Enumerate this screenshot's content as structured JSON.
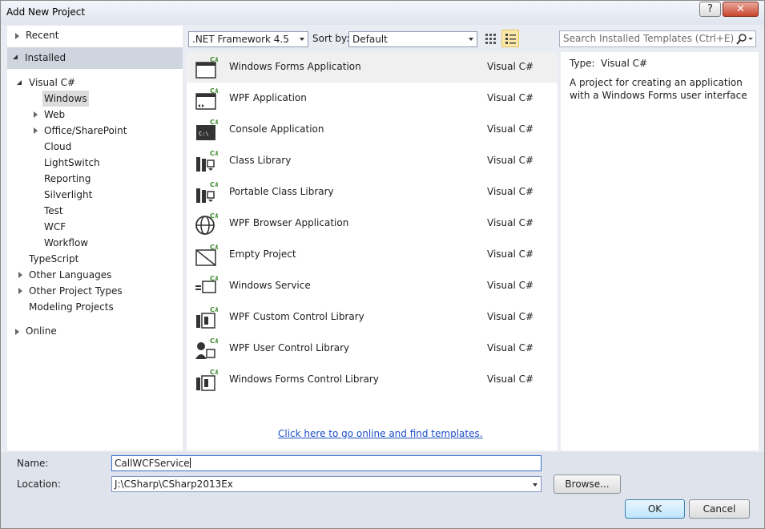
{
  "window": {
    "title": "Add New Project",
    "help_label": "?",
    "close_label": "✕"
  },
  "left": {
    "recent": "Recent",
    "installed": "Installed",
    "online": "Online",
    "tree": [
      {
        "label": "Visual C#",
        "level": 1,
        "expander": "open"
      },
      {
        "label": "Windows",
        "level": 2,
        "expander": "none",
        "selected": true
      },
      {
        "label": "Web",
        "level": 2,
        "expander": "closed"
      },
      {
        "label": "Office/SharePoint",
        "level": 2,
        "expander": "closed"
      },
      {
        "label": "Cloud",
        "level": 2,
        "expander": "none"
      },
      {
        "label": "LightSwitch",
        "level": 2,
        "expander": "none"
      },
      {
        "label": "Reporting",
        "level": 2,
        "expander": "none"
      },
      {
        "label": "Silverlight",
        "level": 2,
        "expander": "none"
      },
      {
        "label": "Test",
        "level": 2,
        "expander": "none"
      },
      {
        "label": "WCF",
        "level": 2,
        "expander": "none"
      },
      {
        "label": "Workflow",
        "level": 2,
        "expander": "none"
      },
      {
        "label": "TypeScript",
        "level": 1,
        "expander": "none"
      },
      {
        "label": "Other Languages",
        "level": 1,
        "expander": "closed"
      },
      {
        "label": "Other Project Types",
        "level": 1,
        "expander": "closed"
      },
      {
        "label": "Modeling Projects",
        "level": 1,
        "expander": "none"
      }
    ]
  },
  "toolbar": {
    "framework": ".NET Framework 4.5",
    "sort_label": "Sort by:",
    "sort_value": "Default",
    "search_placeholder": "Search Installed Templates (Ctrl+E)"
  },
  "templates": [
    {
      "name": "Windows Forms Application",
      "lang": "Visual C#",
      "icon": "windows-forms-icon",
      "selected": true
    },
    {
      "name": "WPF Application",
      "lang": "Visual C#",
      "icon": "wpf-application-icon"
    },
    {
      "name": "Console Application",
      "lang": "Visual C#",
      "icon": "console-application-icon"
    },
    {
      "name": "Class Library",
      "lang": "Visual C#",
      "icon": "class-library-icon"
    },
    {
      "name": "Portable Class Library",
      "lang": "Visual C#",
      "icon": "portable-class-library-icon"
    },
    {
      "name": "WPF Browser Application",
      "lang": "Visual C#",
      "icon": "wpf-browser-icon"
    },
    {
      "name": "Empty Project",
      "lang": "Visual C#",
      "icon": "empty-project-icon"
    },
    {
      "name": "Windows Service",
      "lang": "Visual C#",
      "icon": "windows-service-icon"
    },
    {
      "name": "WPF Custom Control Library",
      "lang": "Visual C#",
      "icon": "wpf-custom-control-icon"
    },
    {
      "name": "WPF User Control Library",
      "lang": "Visual C#",
      "icon": "wpf-user-control-icon"
    },
    {
      "name": "Windows Forms Control Library",
      "lang": "Visual C#",
      "icon": "winforms-control-library-icon"
    }
  ],
  "online_link": "Click here to go online and find templates.",
  "details": {
    "type_label": "Type:",
    "type_value": "Visual C#",
    "description": "A project for creating an application with a Windows Forms user interface"
  },
  "form": {
    "name_label": "Name:",
    "name_value": "CallWCFService",
    "location_label": "Location:",
    "location_value": "J:\\CSharp\\CSharp2013Ex",
    "browse_label": "Browse...",
    "ok_label": "OK",
    "cancel_label": "Cancel"
  },
  "colors": {
    "accent": "#1e4ec8",
    "selection": "#dcdcdc",
    "csharp_badge": "#3a8a2a"
  }
}
